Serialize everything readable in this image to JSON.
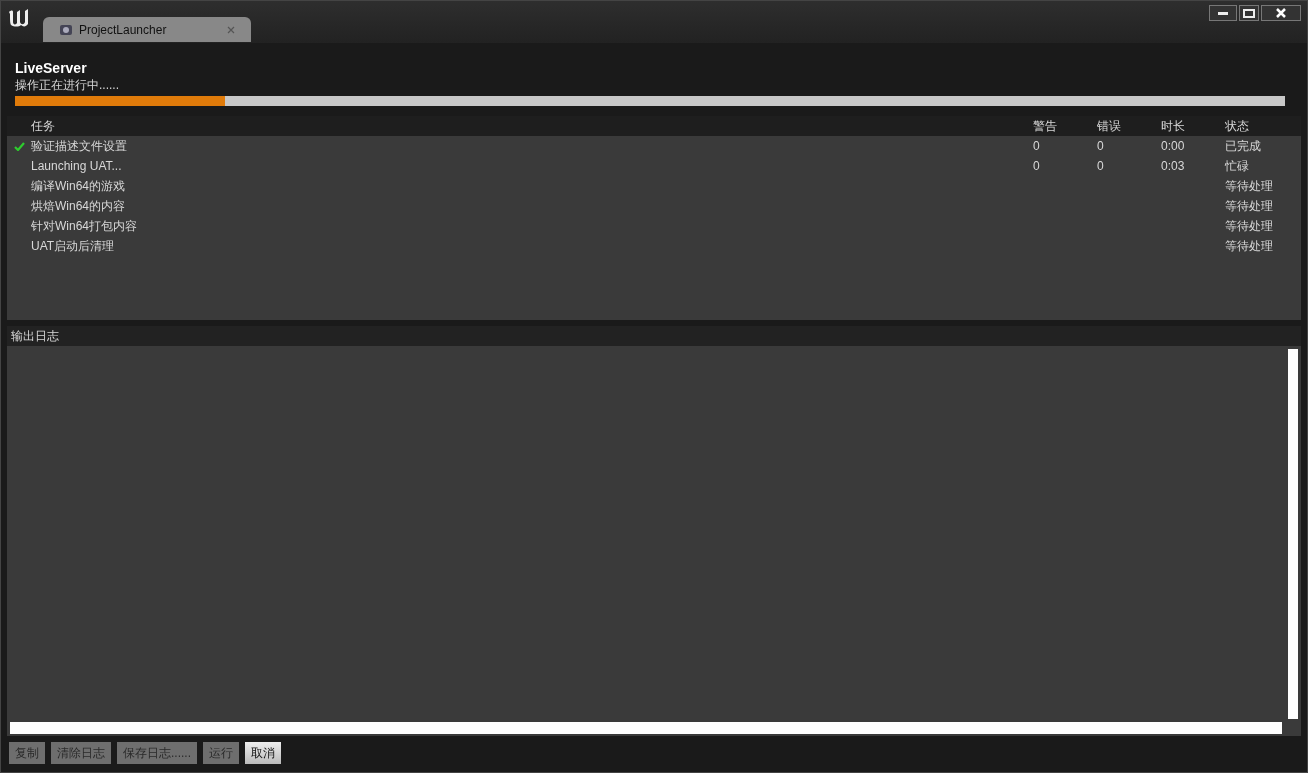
{
  "window": {
    "tab": {
      "title": "ProjectLauncher"
    }
  },
  "profile": {
    "name": "LiveServer",
    "status": "操作正在进行中......",
    "level": 0.165
  },
  "table": {
    "columns": [
      "任务",
      "警告",
      "错误",
      "时长",
      "状态"
    ],
    "rows": [
      {
        "done": true,
        "task": "验证描述文件设置",
        "warnings": "0",
        "errors": "0",
        "duration": "0:00",
        "status": "已完成"
      },
      {
        "done": false,
        "task": "Launching UAT...",
        "warnings": "0",
        "errors": "0",
        "duration": "0:03",
        "status": "忙碌"
      },
      {
        "done": false,
        "task": "编译Win64的游戏",
        "status": "等待处理"
      },
      {
        "done": false,
        "task": "烘焙Win64的内容",
        "status": "等待处理"
      },
      {
        "done": false,
        "task": "针对Win64打包内容",
        "status": "等待处理"
      },
      {
        "done": false,
        "task": "UAT启动后清理",
        "status": "等待处理"
      }
    ]
  },
  "log": {
    "title": "输出日志"
  },
  "buttons": [
    {
      "label": "复制",
      "disabled": true
    },
    {
      "label": "清除日志",
      "disabled": true
    },
    {
      "label": "保存日志......",
      "disabled": true
    },
    {
      "label": "运行",
      "disabled": true
    },
    {
      "label": "取消",
      "disabled": false
    }
  ]
}
